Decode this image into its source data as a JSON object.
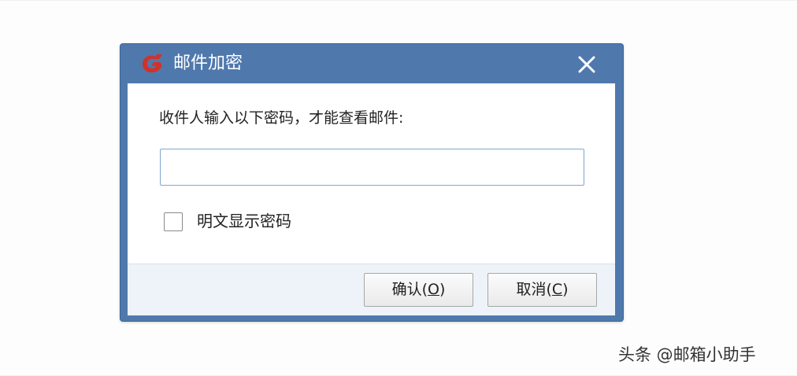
{
  "dialog": {
    "title": "邮件加密",
    "prompt": "收件人输入以下密码，才能查看邮件:",
    "password": {
      "value": "",
      "placeholder": ""
    },
    "show_plaintext_label": "明文显示密码",
    "show_plaintext_checked": false,
    "ok_button": {
      "label_prefix": "确认(",
      "accelerator": "O",
      "label_suffix": ")"
    },
    "cancel_button": {
      "label_prefix": "取消(",
      "accelerator": "C",
      "label_suffix": ")"
    }
  },
  "watermark": "头条 @邮箱小助手",
  "colors": {
    "titlebar": "#4f79ad",
    "accent_icon": "#d0322b",
    "footer": "#eef3f9",
    "input_border": "#7fa7d3"
  },
  "icons": {
    "app": "red-g-logo-icon",
    "close": "close-icon"
  }
}
